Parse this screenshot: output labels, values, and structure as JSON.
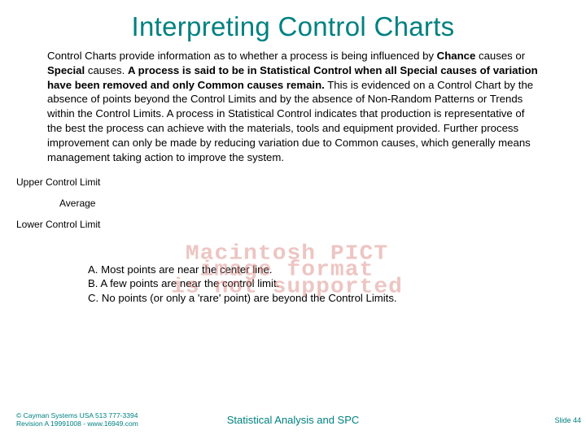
{
  "title": "Interpreting Control Charts",
  "para": {
    "p1a": "Control Charts provide information as to whether a process is being influenced by ",
    "chance": "Chance",
    "p1b": " causes or ",
    "special1": "Special",
    "p1c": " causes. ",
    "bold1": "A process is said to be in Statistical Control when all Special causes of variation have been removed and only Common causes remain.",
    "p2": " This is evidenced on a Control Chart by the absence of points beyond the Control Limits and by the absence of Non-Random Patterns or Trends within the Control Limits. A process in Statistical Control indicates that production is representative of the best the process can achieve with the materials, tools and equipment provided. Further process improvement can only be made by reducing variation due to Common causes, which generally means management taking action to improve the system."
  },
  "labels": {
    "upper": "Upper Control Limit",
    "avg": "Average",
    "lower": "Lower Control Limit"
  },
  "pict": "Macintosh PICT\n image format \nis not supported",
  "bullets": {
    "a": "A.  Most points are near the center line.",
    "b": "B.  A few points are near the control limit.",
    "c": "C.  No points (or only a 'rare' point) are beyond the Control Limits."
  },
  "footer": {
    "left1": "© Cayman Systems USA  513  777-3394",
    "left2": "Revision A 19991008 - www.16949.com",
    "center": "Statistical Analysis and SPC",
    "right": "Slide 44"
  }
}
